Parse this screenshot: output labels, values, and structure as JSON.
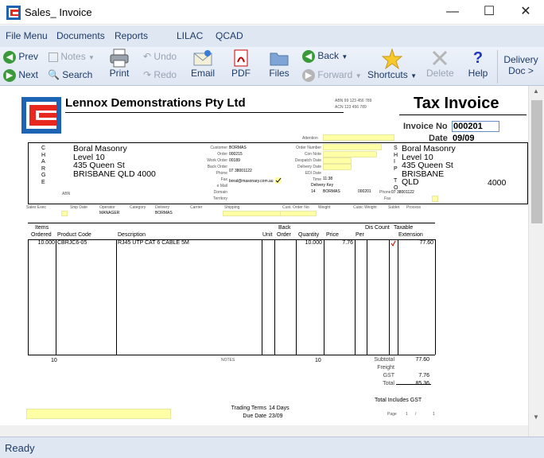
{
  "window": {
    "title": "Sales_ Invoice",
    "min_icon": "minimize-icon",
    "max_icon": "maximize-icon",
    "close_icon": "close-icon"
  },
  "menu": [
    "File Menu",
    "Documents",
    "Reports",
    "LILAC",
    "QCAD"
  ],
  "toolbar": {
    "prev": "Prev",
    "next": "Next",
    "notes": "Notes",
    "search": "Search",
    "print": "Print",
    "undo": "Undo",
    "redo": "Redo",
    "email": "Email",
    "pdf": "PDF",
    "files": "Files",
    "back": "Back",
    "forward": "Forward",
    "shortcuts": "Shortcuts",
    "delete": "Delete",
    "help": "Help",
    "delivery_line1": "Delivery",
    "delivery_line2": "Doc >"
  },
  "invoice": {
    "company": "Lennox Demonstrations Pty Ltd",
    "abn": "ABN 99 123 456 789",
    "acn": "ACN 123 456 789",
    "doc_title": "Tax Invoice",
    "invoice_no_label": "Invoice No",
    "invoice_no": "000201",
    "date_label": "Date",
    "date": "09/09",
    "attention_label": "Attention",
    "charge_letters": [
      "C",
      "H",
      "A",
      "R",
      "G",
      "E"
    ],
    "charge_addr": [
      "Boral Masonry",
      "Level 10",
      "435 Queen St",
      "BRISBANE QLD 4000"
    ],
    "abn_label": "ABN",
    "ship_letters": [
      "S",
      "H",
      "I",
      "P",
      "",
      "T",
      "O"
    ],
    "ship_addr": [
      "Boral Masonry",
      "Level 10",
      "435 Queen St",
      "BRISBANE",
      "QLD"
    ],
    "ship_postcode": "4000",
    "mid_labels": [
      "Customer",
      "Order",
      "Work Order",
      "Back Order",
      "Phone",
      "Fax",
      "e Mail",
      "Domain",
      "Territory"
    ],
    "mid_values": [
      "BORMAS",
      "000215",
      "00189",
      "",
      "07 38001122",
      "",
      "boral@masonary.com.au",
      "",
      ""
    ],
    "right_labels": [
      "Order Number",
      "Con Note",
      "Despatch Date",
      "Delivery Date",
      "EDI Date",
      "Time"
    ],
    "time": "11:38",
    "delivery_key_label": "Delivery Key",
    "delivery_key": [
      "14",
      "BORMAS",
      "000201"
    ],
    "phone_label": "Phone",
    "phone": "07 38001122",
    "fax_label": "Fax",
    "row2_labels": [
      "Sales Exec",
      "Ship Date",
      "Operator",
      "Category",
      "Delivery",
      "Carrier",
      "Shipping",
      "Cust. Order No",
      "Weight",
      "Cubic Weight",
      "Sublet",
      "Process"
    ],
    "operator": "MANAGER",
    "delivery": "BORMAS",
    "col_top": [
      "Items",
      "Back",
      "Dis Count",
      "Taxable"
    ],
    "columns": [
      "Ordered",
      "Product Code",
      "Description",
      "Unit",
      "Order",
      "Quantity",
      "Price",
      "Per",
      "Extension"
    ],
    "line": {
      "ordered": "10.000",
      "code": "CBRJC6-05",
      "description": "RJ45 UTP CAT 6 CABLE 5M",
      "quantity": "10.000",
      "price": "7.76",
      "extension": "77.60"
    },
    "totals_items": "10",
    "notes_label": "NOTES",
    "totals_qty": "10",
    "summary": [
      {
        "label": "Subtotal",
        "value": "77.60"
      },
      {
        "label": "Freight",
        "value": ""
      },
      {
        "label": "GST",
        "value": "7.76"
      },
      {
        "label": "Total",
        "value": "85.36"
      }
    ],
    "total_includes": "Total Includes GST",
    "trading_terms_label": "Trading Terms",
    "trading_terms": "14 Days",
    "due_date_label": "Due Date",
    "due_date": "23/09",
    "page_label": "Page",
    "page": "1",
    "page_sep": "/",
    "page_total": "1"
  },
  "status": "Ready",
  "colors": {
    "menubar": "#dfe7f3",
    "field_yellow": "#ffffa6",
    "logo_blue": "#1e64b4",
    "logo_red": "#e8281e"
  }
}
